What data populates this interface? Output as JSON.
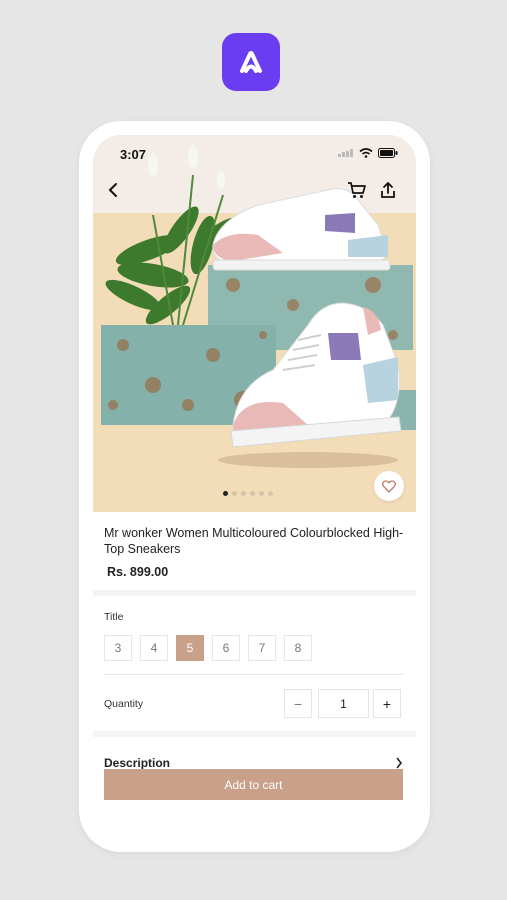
{
  "app": {
    "logo_icon": "app-logo-icon",
    "accent": "#6a3df0"
  },
  "status_bar": {
    "time": "3:07"
  },
  "product": {
    "title": "Mr wonker Women Multicoloured Colourblocked High-Top Sneakers",
    "price": "Rs. 899.00",
    "image_count": 6,
    "active_image": 1
  },
  "options": {
    "label": "Title",
    "sizes": [
      "3",
      "4",
      "5",
      "6",
      "7",
      "8"
    ],
    "selected": "5"
  },
  "quantity": {
    "label": "Quantity",
    "value": "1",
    "minus": "−",
    "plus": "+"
  },
  "description": {
    "label": "Description"
  },
  "cta": {
    "label": "Add to cart",
    "color": "#c9a08a"
  }
}
